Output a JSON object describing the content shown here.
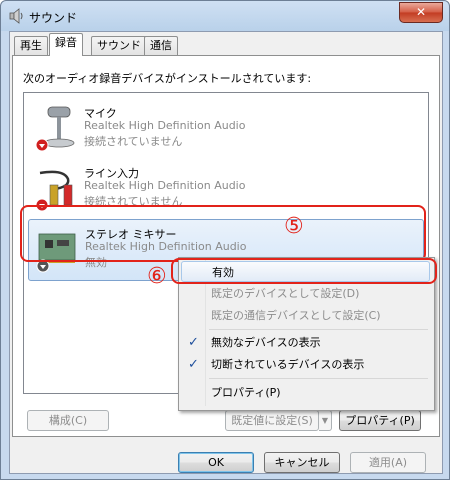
{
  "window": {
    "title": "サウンド",
    "close_label": "✕"
  },
  "tabs": [
    {
      "label": "再生"
    },
    {
      "label": "録音"
    },
    {
      "label": "サウンド"
    },
    {
      "label": "通信"
    }
  ],
  "panel": {
    "description": "次のオーディオ録音デバイスがインストールされています:"
  },
  "devices": [
    {
      "name": "マイク",
      "driver": "Realtek High Definition Audio",
      "status": "接続されていません"
    },
    {
      "name": "ライン入力",
      "driver": "Realtek High Definition Audio",
      "status": "接続されていません"
    },
    {
      "name": "ステレオ ミキサー",
      "driver": "Realtek High Definition Audio",
      "status": "無効"
    }
  ],
  "callouts": {
    "five": "⑤",
    "six": "⑥"
  },
  "context_menu": {
    "enable": "有効",
    "set_default": "既定のデバイスとして設定(D)",
    "set_default_comm": "既定の通信デバイスとして設定(C)",
    "show_disabled": "無効なデバイスの表示",
    "show_disconnected": "切断されているデバイスの表示",
    "properties": "プロパティ(P)",
    "check_mark": "✓"
  },
  "panel_buttons": {
    "configure": "構成(C)",
    "set_default": "既定値に設定(S)",
    "split_arrow": "▼",
    "properties": "プロパティ(P)"
  },
  "dialog_buttons": {
    "ok": "OK",
    "cancel": "キャンセル",
    "apply": "適用(A)"
  },
  "colors": {
    "highlight_red": "#e2231a",
    "selected_blue": "#d3e5f8"
  }
}
